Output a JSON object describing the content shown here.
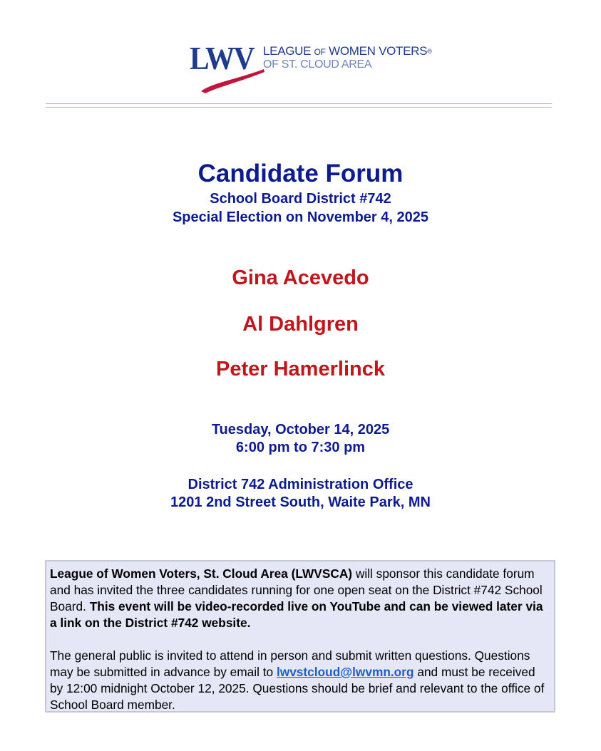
{
  "logo": {
    "mark": "LWV",
    "line1_a": "LEAGUE ",
    "line1_of": "OF",
    "line1_b": " WOMEN VOTERS",
    "registered": "®",
    "line2": "OF ST. CLOUD AREA",
    "colors": {
      "navy": "#1f3c8c",
      "light_blue": "#6f86b3",
      "swoosh": "#c0143c"
    }
  },
  "heading": {
    "title": "Candidate Forum",
    "subtitle1": "School Board District #742",
    "subtitle2": "Special Election on November 4, 2025"
  },
  "candidates": [
    "Gina Acevedo",
    "Al Dahlgren",
    "Peter Hamerlinck"
  ],
  "event": {
    "date": "Tuesday, October 14, 2025",
    "time": "6:00 pm to 7:30 pm",
    "location_name": "District 742 Administration Office",
    "address": "1201 2nd Street South, Waite Park, MN"
  },
  "notice": {
    "p1_bold1": "League of Women Voters, St. Cloud Area (LWVSCA)",
    "p1_text1": " will sponsor this candidate forum and has invited the three candidates running for one open seat on the District #742 School Board. ",
    "p1_bold2": "This event will be video-recorded live on YouTube and can be viewed later via a link on the District #742 website.",
    "p2_text1": "The general public is invited to attend in person and submit written questions. Questions may be submitted in advance by email to ",
    "p2_email": "lwvstcloud@lwvmn.org",
    "p2_text2": " and must be received by 12:00 midnight October 12, 2025. Questions should be brief and relevant to the office of School Board member."
  },
  "colors": {
    "title_blue": "#0c1b8f",
    "candidate_red": "#c0171d",
    "box_bg": "#e6e7f6",
    "rule_pink": "#e3a3ab",
    "link": "#1a5fc7"
  }
}
